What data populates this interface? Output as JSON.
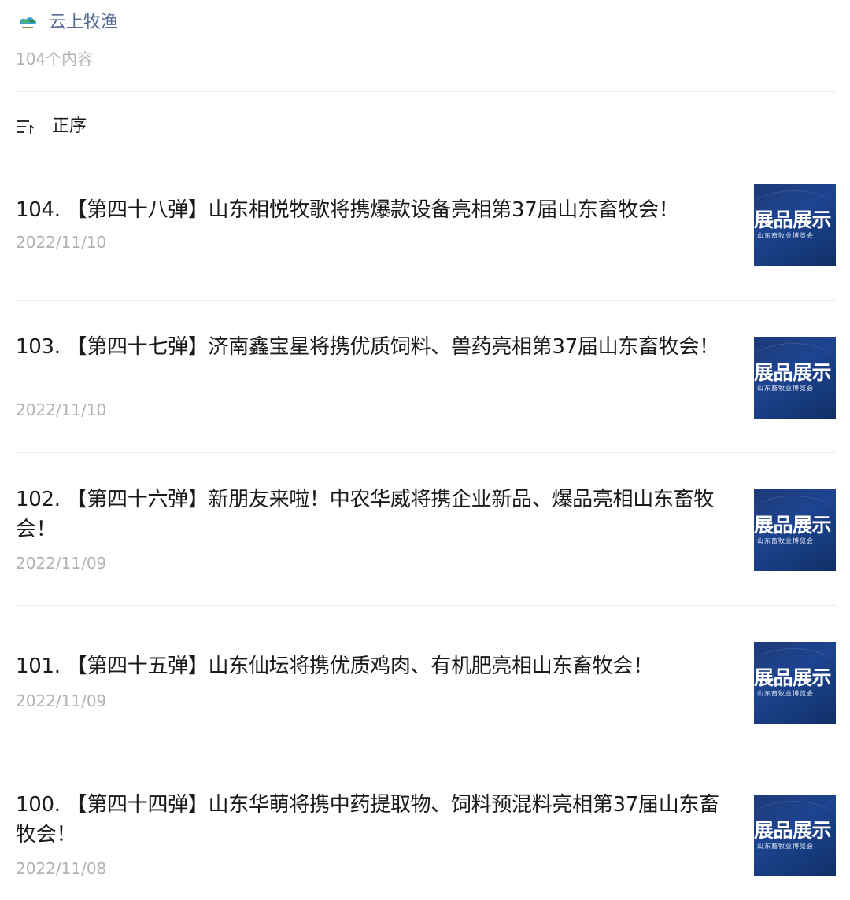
{
  "account": {
    "name": "云上牧渔",
    "logo_icon": "cloud-fish-logo-icon",
    "brand_color": "#576b95"
  },
  "content_count": "104个内容",
  "sort": {
    "icon": "sort-order-icon",
    "label": "正序"
  },
  "thumbnail": {
    "title": "展品展示",
    "subtitle": "山东畜牧业博览会",
    "background_color": "#1e4490"
  },
  "articles": [
    {
      "title": "104. 【第四十八弹】山东相悦牧歌将携爆款设备亮相第37届山东畜牧会！",
      "date": "2022/11/10"
    },
    {
      "title": "103. 【第四十七弹】济南鑫宝星将携优质饲料、兽药亮相第37届山东畜牧会！",
      "date": "2022/11/10"
    },
    {
      "title": "102. 【第四十六弹】新朋友来啦！中农华威将携企业新品、爆品亮相山东畜牧会！",
      "date": "2022/11/09"
    },
    {
      "title": "101. 【第四十五弹】山东仙坛将携优质鸡肉、有机肥亮相山东畜牧会！",
      "date": "2022/11/09"
    },
    {
      "title": "100. 【第四十四弹】山东华萌将携中药提取物、饲料预混料亮相第37届山东畜牧会！",
      "date": "2022/11/08"
    }
  ]
}
